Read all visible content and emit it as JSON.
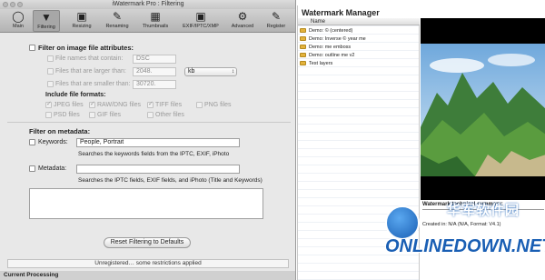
{
  "window": {
    "title": "iWatermark Pro : Filtering",
    "toolbar": [
      "Main",
      "Filtering",
      "Resizing",
      "Renaming",
      "Thumbnails",
      "EXIF/IPTC/XMP",
      "Advanced",
      "Register"
    ],
    "active_tab": "Filtering"
  },
  "filter": {
    "heading": "Filter on image file attributes:",
    "names_label": "File names that contain:",
    "names_value": "DSC",
    "larger_label": "Files that are larger than:",
    "larger_value": "2048.",
    "size_unit": "kb",
    "smaller_label": "Files that are smaller than:",
    "smaller_value": "30720.",
    "formats_heading": "Include file formats:",
    "formats": {
      "jpeg": "JPEG files",
      "raw": "RAW/DNG files",
      "tiff": "TIFF files",
      "png": "PNG files",
      "psd": "PSD files",
      "gif": "GIF files",
      "other": "Other files"
    }
  },
  "metadata": {
    "heading": "Filter on metadata:",
    "keywords_label": "Keywords:",
    "keywords_value": "People, Portrait",
    "keywords_hint": "Searches the keywords fields from the IPTC, EXIF, iPhoto",
    "metadata_label": "Metadata:",
    "metadata_value": "",
    "metadata_hint": "Searches the IPTC fields, EXIF fields, and iPhoto (Title and Keywords)"
  },
  "reset_button": "Reset Filtering to Defaults",
  "status_text": "Unregistered… some restrictions applied",
  "bottom_label": "Current Processing",
  "manager": {
    "title": "Watermark Manager",
    "column": "Name",
    "items": [
      "Demo: © (centered)",
      "Demo: Inverse © year me",
      "Demo: me emboss",
      "Demo: outline me v2",
      "Test layers"
    ],
    "tech_title": "Watermark technical summary:",
    "tech_text": "Created in: N/A (N/A, Format: V4.1)"
  },
  "overlay": {
    "cn": "华军软件园",
    "en": "ONLINEDOWN.NET"
  }
}
